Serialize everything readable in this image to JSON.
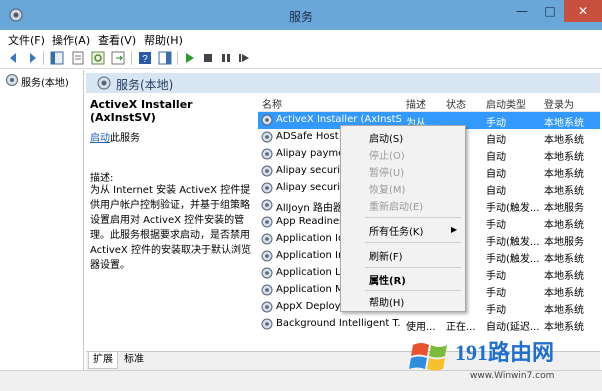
{
  "window": {
    "title": "服务"
  },
  "menubar": {
    "items": [
      "文件(F)",
      "操作(A)",
      "查看(V)",
      "帮助(H)"
    ]
  },
  "tree": {
    "root_label": "服务(本地)"
  },
  "panel": {
    "header": "服务(本地)"
  },
  "detail": {
    "service_title": "ActiveX Installer (AxInstSV)",
    "start_link": "启动",
    "start_suffix": "此服务",
    "desc_label": "描述:",
    "desc_text": "为从 Internet 安装 ActiveX 控件提供用户帐户控制验证，并基于组策略设置启用对 ActiveX 控件安装的管理。此服务根据要求启动，是否禁用 ActiveX 控件的安装取决于默认浏览器设置。"
  },
  "list": {
    "columns": [
      "名称",
      "描述",
      "状态",
      "启动类型",
      "登录为"
    ],
    "rows": [
      {
        "name": "ActiveX Installer (AxInstSV)",
        "desc": "为从...",
        "status": "",
        "start": "手动",
        "logon": "本地系统",
        "selected": true
      },
      {
        "name": "ADSafe Host S",
        "desc": "",
        "status": "",
        "start": "自动",
        "logon": "本地系统"
      },
      {
        "name": "Alipay paymer",
        "desc": "",
        "status": "",
        "start": "自动",
        "logon": "本地系统"
      },
      {
        "name": "Alipay security",
        "desc": "",
        "status": "",
        "start": "自动",
        "logon": "本地系统"
      },
      {
        "name": "Alipay security",
        "desc": "",
        "status": "",
        "start": "自动",
        "logon": "本地系统"
      },
      {
        "name": "AllJoyn 路由器",
        "desc": "",
        "status": "",
        "start": "手动(触发...",
        "logon": "本地服务"
      },
      {
        "name": "App Readines",
        "desc": "",
        "status": "",
        "start": "手动",
        "logon": "本地系统"
      },
      {
        "name": "Application Id",
        "desc": "",
        "status": "",
        "start": "手动(触发...",
        "logon": "本地服务"
      },
      {
        "name": "Application In",
        "desc": "",
        "status": "",
        "start": "手动(触发...",
        "logon": "本地系统"
      },
      {
        "name": "Application La",
        "desc": "",
        "status": "",
        "start": "手动",
        "logon": "本地系统"
      },
      {
        "name": "Application M",
        "desc": "",
        "status": "",
        "start": "手动",
        "logon": "本地系统"
      },
      {
        "name": "AppX Deploym",
        "desc": "",
        "status": "",
        "start": "手动",
        "logon": "本地系统"
      },
      {
        "name": "Background Intelligent T...",
        "desc": "使用...",
        "status": "正在...",
        "start": "自动(延迟...",
        "logon": "本地系统"
      },
      {
        "name": "",
        "desc": "",
        "status": "",
        "start": "",
        "logon": ""
      }
    ]
  },
  "context_menu": {
    "items": [
      {
        "label": "启动(S)",
        "disabled": false
      },
      {
        "label": "停止(O)",
        "disabled": true
      },
      {
        "label": "暂停(U)",
        "disabled": true
      },
      {
        "label": "恢复(M)",
        "disabled": true
      },
      {
        "label": "重新启动(E)",
        "disabled": true
      },
      {
        "label": "所有任务(K)",
        "disabled": false
      },
      {
        "label": "刷新(F)",
        "disabled": false
      },
      {
        "label": "属性(R)",
        "disabled": false
      },
      {
        "label": "帮助(H)",
        "disabled": false
      }
    ]
  },
  "tabs": {
    "extended": "扩展",
    "standard": "标准"
  },
  "watermark": {
    "site": "191路由网",
    "url": "www.Winwin7.com"
  },
  "colors": {
    "titlebar": "#6aa7d9",
    "selection": "#3399ff",
    "close": "#c7503f"
  }
}
